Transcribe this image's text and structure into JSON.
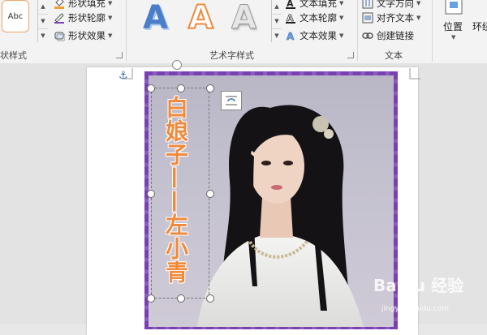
{
  "ribbon": {
    "shape_styles": {
      "swatch_label": "Abc",
      "group_label": "状样式",
      "commands": [
        {
          "label": "形状填充",
          "icon": "fill-bucket-icon"
        },
        {
          "label": "形状轮廓",
          "icon": "pen-outline-icon"
        },
        {
          "label": "形状效果",
          "icon": "shape-effects-icon"
        }
      ]
    },
    "wordart_styles": {
      "group_label": "艺术字样式",
      "samples": [
        {
          "glyph": "A",
          "color": "#4a7ec8"
        },
        {
          "glyph": "A",
          "color": "#f08a3c"
        },
        {
          "glyph": "A",
          "color": "#b8b8b8"
        }
      ],
      "commands": [
        {
          "label": "文本填充",
          "icon": "text-fill-icon"
        },
        {
          "label": "文本轮廓",
          "icon": "text-outline-icon"
        },
        {
          "label": "文本效果",
          "icon": "text-effects-icon"
        }
      ]
    },
    "text": {
      "group_label": "文本",
      "commands": [
        {
          "label": "文字方向",
          "icon": "text-direction-icon"
        },
        {
          "label": "对齐文本",
          "icon": "align-text-icon"
        },
        {
          "label": "创建链接",
          "icon": "link-icon"
        }
      ]
    },
    "arrange": {
      "position_label": "位置",
      "wrap_label": "环绕"
    }
  },
  "document": {
    "vertical_text": "白娘子——左小青",
    "text_color": "#f08a3c",
    "frame_color": "#7a3fb2"
  },
  "watermark": {
    "brand": "Baidu 经验",
    "url": "jingyan.baidu.com"
  }
}
